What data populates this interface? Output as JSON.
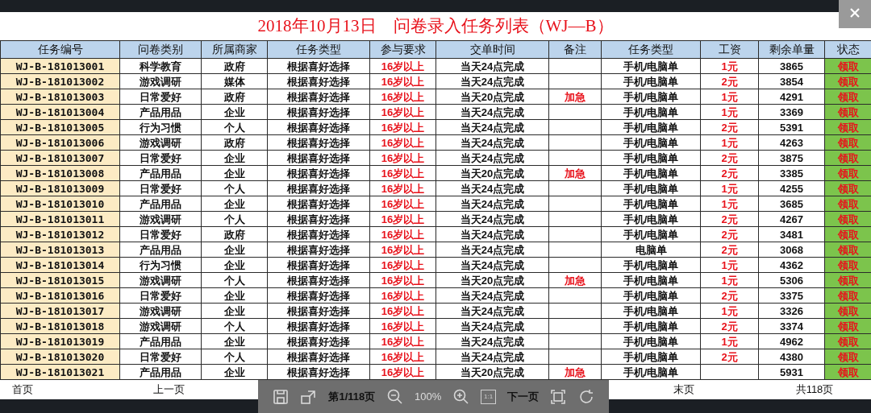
{
  "title": "2018年10月13日　问卷录入任务列表（WJ—B）",
  "table": {
    "columns": [
      {
        "label": "任务编号",
        "kind": "id"
      },
      {
        "label": "问卷类别",
        "kind": "plain"
      },
      {
        "label": "所属商家",
        "kind": "plain"
      },
      {
        "label": "任务类型",
        "kind": "plain"
      },
      {
        "label": "参与要求",
        "kind": "red"
      },
      {
        "label": "交单时间",
        "kind": "plain"
      },
      {
        "label": "备注",
        "kind": "red"
      },
      {
        "label": "任务类型",
        "kind": "plain"
      },
      {
        "label": "工资",
        "kind": "red"
      },
      {
        "label": "剩余单量",
        "kind": "plain"
      },
      {
        "label": "状态",
        "kind": "status"
      }
    ],
    "rows": [
      {
        "id": "WJ-B-181013001",
        "category": "科学教育",
        "merchant": "政府",
        "task_type": "根据喜好选择",
        "requirement": "16岁以上",
        "deadline": "当天24点完成",
        "device": "手机/电脑单",
        "wage": "1元",
        "remaining": "3865",
        "status": "领取"
      },
      {
        "id": "WJ-B-181013002",
        "category": "游戏调研",
        "merchant": "媒体",
        "task_type": "根据喜好选择",
        "requirement": "16岁以上",
        "deadline": "当天24点完成",
        "device": "手机/电脑单",
        "wage": "2元",
        "remaining": "3854",
        "status": "领取"
      },
      {
        "id": "WJ-B-181013003",
        "category": "日常爱好",
        "merchant": "政府",
        "task_type": "根据喜好选择",
        "requirement": "16岁以上",
        "deadline": "当天20点完成",
        "note": "加急",
        "device": "手机/电脑单",
        "wage": "1元",
        "remaining": "4291",
        "status": "领取"
      },
      {
        "id": "WJ-B-181013004",
        "category": "产品用品",
        "merchant": "企业",
        "task_type": "根据喜好选择",
        "requirement": "16岁以上",
        "deadline": "当天24点完成",
        "device": "手机/电脑单",
        "wage": "1元",
        "remaining": "3369",
        "status": "领取"
      },
      {
        "id": "WJ-B-181013005",
        "category": "行为习惯",
        "merchant": "个人",
        "task_type": "根据喜好选择",
        "requirement": "16岁以上",
        "deadline": "当天24点完成",
        "device": "手机/电脑单",
        "wage": "2元",
        "remaining": "5391",
        "status": "领取"
      },
      {
        "id": "WJ-B-181013006",
        "category": "游戏调研",
        "merchant": "政府",
        "task_type": "根据喜好选择",
        "requirement": "16岁以上",
        "deadline": "当天24点完成",
        "device": "手机/电脑单",
        "wage": "1元",
        "remaining": "4263",
        "status": "领取"
      },
      {
        "id": "WJ-B-181013007",
        "category": "日常爱好",
        "merchant": "企业",
        "task_type": "根据喜好选择",
        "requirement": "16岁以上",
        "deadline": "当天24点完成",
        "device": "手机/电脑单",
        "wage": "2元",
        "remaining": "3875",
        "status": "领取"
      },
      {
        "id": "WJ-B-181013008",
        "category": "产品用品",
        "merchant": "企业",
        "task_type": "根据喜好选择",
        "requirement": "16岁以上",
        "deadline": "当天20点完成",
        "note": "加急",
        "device": "手机/电脑单",
        "wage": "2元",
        "remaining": "3385",
        "status": "领取"
      },
      {
        "id": "WJ-B-181013009",
        "category": "日常爱好",
        "merchant": "个人",
        "task_type": "根据喜好选择",
        "requirement": "16岁以上",
        "deadline": "当天24点完成",
        "device": "手机/电脑单",
        "wage": "1元",
        "remaining": "4255",
        "status": "领取"
      },
      {
        "id": "WJ-B-181013010",
        "category": "产品用品",
        "merchant": "企业",
        "task_type": "根据喜好选择",
        "requirement": "16岁以上",
        "deadline": "当天24点完成",
        "device": "手机/电脑单",
        "wage": "1元",
        "remaining": "3685",
        "status": "领取"
      },
      {
        "id": "WJ-B-181013011",
        "category": "游戏调研",
        "merchant": "个人",
        "task_type": "根据喜好选择",
        "requirement": "16岁以上",
        "deadline": "当天24点完成",
        "device": "手机/电脑单",
        "wage": "2元",
        "remaining": "4267",
        "status": "领取"
      },
      {
        "id": "WJ-B-181013012",
        "category": "日常爱好",
        "merchant": "政府",
        "task_type": "根据喜好选择",
        "requirement": "16岁以上",
        "deadline": "当天24点完成",
        "device": "手机/电脑单",
        "wage": "2元",
        "remaining": "3481",
        "status": "领取"
      },
      {
        "id": "WJ-B-181013013",
        "category": "产品用品",
        "merchant": "企业",
        "task_type": "根据喜好选择",
        "requirement": "16岁以上",
        "deadline": "当天24点完成",
        "device": "电脑单",
        "wage": "2元",
        "remaining": "3068",
        "status": "领取"
      },
      {
        "id": "WJ-B-181013014",
        "category": "行为习惯",
        "merchant": "企业",
        "task_type": "根据喜好选择",
        "requirement": "16岁以上",
        "deadline": "当天24点完成",
        "device": "手机/电脑单",
        "wage": "1元",
        "remaining": "4362",
        "status": "领取"
      },
      {
        "id": "WJ-B-181013015",
        "category": "游戏调研",
        "merchant": "个人",
        "task_type": "根据喜好选择",
        "requirement": "16岁以上",
        "deadline": "当天20点完成",
        "note": "加急",
        "device": "手机/电脑单",
        "wage": "1元",
        "remaining": "5306",
        "status": "领取"
      },
      {
        "id": "WJ-B-181013016",
        "category": "日常爱好",
        "merchant": "企业",
        "task_type": "根据喜好选择",
        "requirement": "16岁以上",
        "deadline": "当天24点完成",
        "device": "手机/电脑单",
        "wage": "2元",
        "remaining": "3375",
        "status": "领取"
      },
      {
        "id": "WJ-B-181013017",
        "category": "游戏调研",
        "merchant": "企业",
        "task_type": "根据喜好选择",
        "requirement": "16岁以上",
        "deadline": "当天24点完成",
        "device": "手机/电脑单",
        "wage": "1元",
        "remaining": "3326",
        "status": "领取"
      },
      {
        "id": "WJ-B-181013018",
        "category": "游戏调研",
        "merchant": "个人",
        "task_type": "根据喜好选择",
        "requirement": "16岁以上",
        "deadline": "当天24点完成",
        "device": "手机/电脑单",
        "wage": "2元",
        "remaining": "3374",
        "status": "领取"
      },
      {
        "id": "WJ-B-181013019",
        "category": "产品用品",
        "merchant": "企业",
        "task_type": "根据喜好选择",
        "requirement": "16岁以上",
        "deadline": "当天24点完成",
        "device": "手机/电脑单",
        "wage": "1元",
        "remaining": "4962",
        "status": "领取"
      },
      {
        "id": "WJ-B-181013020",
        "category": "日常爱好",
        "merchant": "个人",
        "task_type": "根据喜好选择",
        "requirement": "16岁以上",
        "deadline": "当天24点完成",
        "device": "手机/电脑单",
        "wage": "2元",
        "remaining": "4380",
        "status": "领取"
      },
      {
        "id": "WJ-B-181013021",
        "category": "产品用品",
        "merchant": "企业",
        "task_type": "根据喜好选择",
        "requirement": "16岁以上",
        "deadline": "当天20点完成",
        "note": "加急",
        "device": "手机/电脑单",
        "remaining": "5931",
        "status": "领取"
      }
    ]
  },
  "footer": {
    "first": "首页",
    "prev": "上一页",
    "next": "下一页",
    "last": "末页",
    "total": "共118页"
  },
  "viewer_toolbar": {
    "page": "第1/118页",
    "zoom": "100%",
    "actual_size": "1:1"
  }
}
